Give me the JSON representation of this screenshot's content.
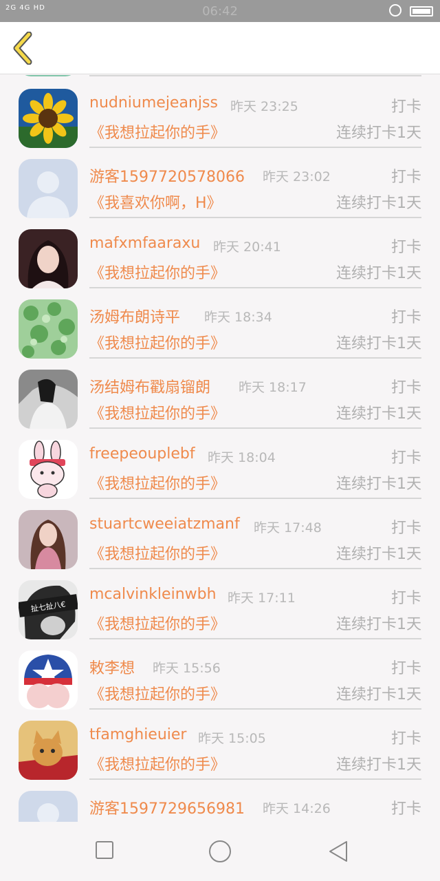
{
  "status_bar": {
    "signal": "2G 4G HD",
    "time": "06:42"
  },
  "header": {
    "back_icon": "chevron-left-icon"
  },
  "entries": [
    {
      "name": "nudniumejeanjss",
      "time": "昨天 23:25",
      "action": "打卡",
      "title": "《我想拉起你的手》",
      "streak": "连续打卡1天",
      "avatar": "sunflower"
    },
    {
      "name": "游客1597720578066",
      "time": "昨天 23:02",
      "action": "打卡",
      "title": "《我喜欢你啊，H》",
      "streak": "连续打卡1天",
      "avatar": "default-user"
    },
    {
      "name": "mafxmfaaraxu",
      "time": "昨天 20:41",
      "action": "打卡",
      "title": "《我想拉起你的手》",
      "streak": "连续打卡1天",
      "avatar": "girl-photo"
    },
    {
      "name": "汤姆布朗诗平",
      "time": "昨天 18:34",
      "action": "打卡",
      "title": "《我想拉起你的手》",
      "streak": "连续打卡1天",
      "avatar": "clover"
    },
    {
      "name": "汤结姆布戳扇镏朗",
      "time": "昨天 18:17",
      "action": "打卡",
      "title": "《我想拉起你的手》",
      "streak": "连续打卡1天",
      "avatar": "bw-girl"
    },
    {
      "name": "freepeouplebf",
      "time": "昨天 18:04",
      "action": "打卡",
      "title": "《我想拉起你的手》",
      "streak": "连续打卡1天",
      "avatar": "cartoon-rabbit"
    },
    {
      "name": "stuartcweeiatzmanf",
      "time": "昨天 17:48",
      "action": "打卡",
      "title": "《我想拉起你的手》",
      "streak": "连续打卡1天",
      "avatar": "girl-dress"
    },
    {
      "name": "mcalvinkleinwbh",
      "time": "昨天 17:11",
      "action": "打卡",
      "title": "《我想拉起你的手》",
      "streak": "连续打卡1天",
      "avatar": "bw-mask",
      "avatar_text": "扯七扯八€"
    },
    {
      "name": "敕李想",
      "time": "昨天 15:56",
      "action": "打卡",
      "title": "《我想拉起你的手》",
      "streak": "连续打卡1天",
      "avatar": "captain-shorts"
    },
    {
      "name": "tfamghieuier",
      "time": "昨天 15:05",
      "action": "打卡",
      "title": "《我想拉起你的手》",
      "streak": "连续打卡1天",
      "avatar": "cat"
    },
    {
      "name": "游客1597729656981",
      "time": "昨天 14:26",
      "action": "打卡",
      "title": "",
      "streak": "",
      "avatar": "default-user"
    }
  ],
  "nav": {
    "recent": "square-icon",
    "home": "circle-icon",
    "back": "triangle-back-icon"
  },
  "colors": {
    "accent": "#ef8a4c",
    "muted": "#b0b0b0",
    "status_bar": "#9a9a9a"
  }
}
